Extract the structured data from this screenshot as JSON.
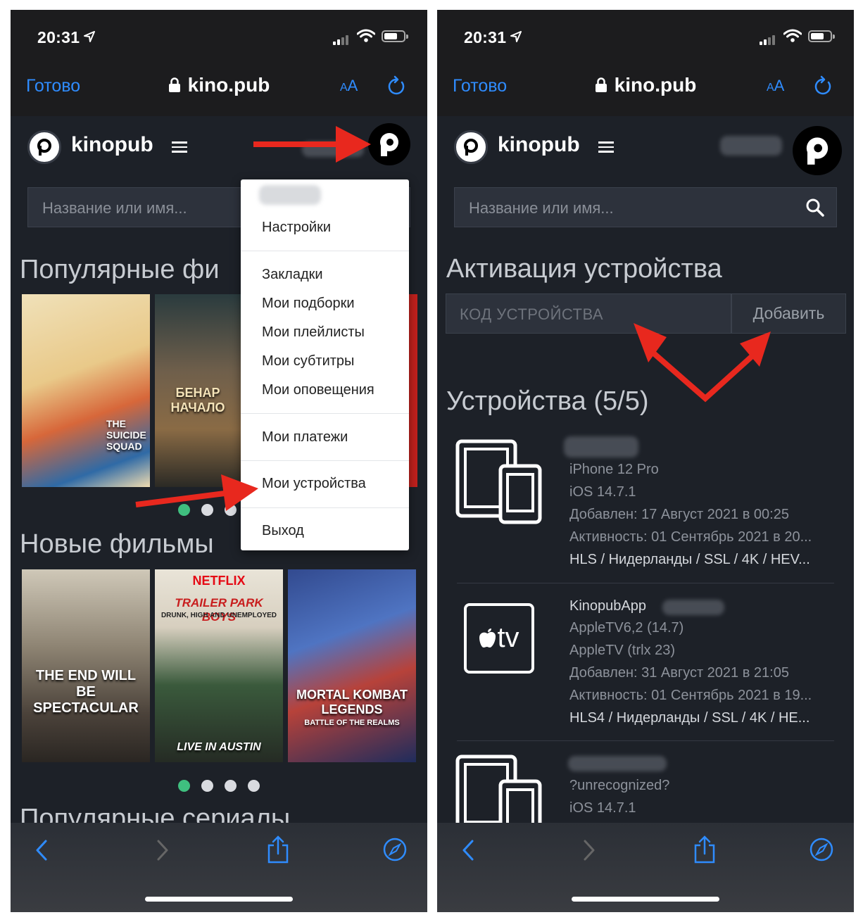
{
  "status_bar": {
    "time": "20:31"
  },
  "browser": {
    "done_label": "Готово",
    "url": "kino.pub",
    "text_size_label": "AA",
    "text_size_small": "A"
  },
  "site": {
    "brand": "kinopub",
    "search_placeholder": "Название или имя..."
  },
  "left": {
    "sections": {
      "popular_films": "Популярные фи",
      "new_films": "Новые фильмы",
      "popular_series": "Популярные сериалы"
    },
    "popular_posters": [
      "THE SUICIDE SQUAD",
      "БЕНАР НАЧАЛО"
    ],
    "new_posters": [
      {
        "top": "",
        "title": "THE END WILL BE SPECTACULAR",
        "sub": ""
      },
      {
        "top": "NETFLIX",
        "title": "TRAILER PARK BOYS",
        "sub": "DRUNK, HIGH AND UNEMPLOYED",
        "bottom": "LIVE IN AUSTIN"
      },
      {
        "top": "",
        "title": "MORTAL KOMBAT LEGENDS",
        "sub": "BATTLE OF THE REALMS"
      }
    ],
    "menu": {
      "settings": "Настройки",
      "bookmarks": "Закладки",
      "my_collections": "Мои подборки",
      "my_playlists": "Мои плейлисты",
      "my_subtitles": "Мои субтитры",
      "my_notifications": "Мои оповещения",
      "my_payments": "Мои платежи",
      "my_devices": "Мои устройства",
      "logout": "Выход"
    }
  },
  "right": {
    "activation_title": "Активация устройства",
    "code_placeholder": "КОД УСТРОЙСТВА",
    "add_button": "Добавить",
    "devices_title": "Устройства (5/5)",
    "devices": [
      {
        "name": "",
        "lines": [
          "iPhone 12 Pro",
          "iOS 14.7.1",
          "Добавлен: 17 Август 2021 в 00:25",
          "Активность: 01 Сентябрь 2021 в 20..."
        ],
        "settings": "HLS / Нидерланды / SSL / 4K / HEV..."
      },
      {
        "name": "KinopubApp",
        "lines": [
          "AppleTV6,2 (14.7)",
          "AppleTV (trlx 23)",
          "Добавлен: 31 Август 2021 в 21:05",
          "Активность: 01 Сентябрь 2021 в 19..."
        ],
        "settings": "HLS4 / Нидерланды / SSL / 4K / HE..."
      },
      {
        "name": "",
        "lines": [
          "?unrecognized?",
          "iOS 14.7.1"
        ],
        "settings": ""
      }
    ],
    "appletv_icon_text": "tv"
  },
  "colors": {
    "accent_blue": "#2f8cff",
    "page_bg": "#1d2128",
    "dot_active": "#3fbf7f",
    "arrow_red": "#e8281e"
  }
}
